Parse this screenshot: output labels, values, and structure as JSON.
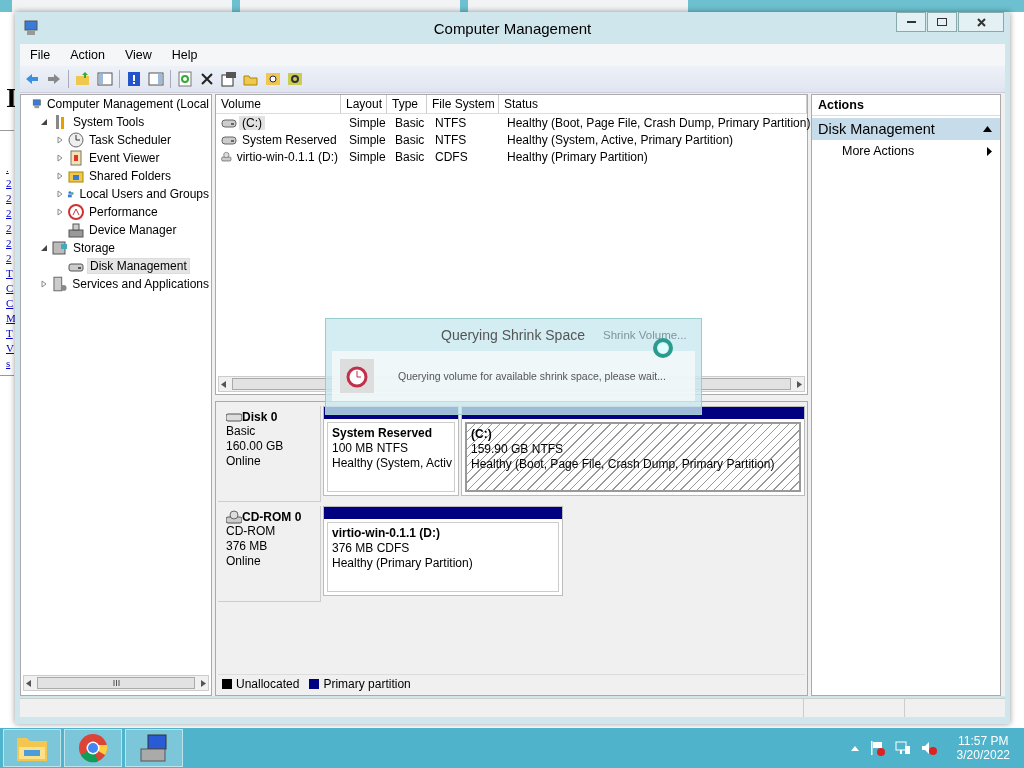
{
  "background_page": {
    "heading_fragment": "I",
    "link_fragments": [
      ".",
      "2",
      "2",
      "2",
      "2",
      "2",
      "2",
      "T",
      "C",
      "C",
      "M",
      "T",
      "V",
      "s"
    ]
  },
  "window": {
    "title": "Computer Management"
  },
  "menu": [
    "File",
    "Action",
    "View",
    "Help"
  ],
  "tree": [
    {
      "label": "Computer Management (Local",
      "selected": false,
      "children": [
        {
          "label": "System Tools",
          "expanded": true,
          "selected": false,
          "children": [
            {
              "label": "Task Scheduler",
              "expanded": false,
              "selected": false
            },
            {
              "label": "Event Viewer",
              "expanded": false,
              "selected": false
            },
            {
              "label": "Shared Folders",
              "expanded": false,
              "selected": false
            },
            {
              "label": "Local Users and Groups",
              "expanded": false,
              "selected": false
            },
            {
              "label": "Performance",
              "expanded": false,
              "selected": false
            },
            {
              "label": "Device Manager",
              "selected": false
            }
          ]
        },
        {
          "label": "Storage",
          "expanded": true,
          "selected": false,
          "children": [
            {
              "label": "Disk Management",
              "selected": true
            }
          ]
        },
        {
          "label": "Services and Applications",
          "expanded": false,
          "selected": false
        }
      ]
    }
  ],
  "volume_table": {
    "columns": [
      "Volume",
      "Layout",
      "Type",
      "File System",
      "Status"
    ],
    "rows": [
      {
        "cells": [
          "(C:)",
          "Simple",
          "Basic",
          "NTFS",
          "Healthy (Boot, Page File, Crash Dump, Primary Partition)"
        ],
        "selected": true,
        "kind": "disk"
      },
      {
        "cells": [
          "System Reserved",
          "Simple",
          "Basic",
          "NTFS",
          "Healthy (System, Active, Primary Partition)"
        ],
        "selected": false,
        "kind": "disk"
      },
      {
        "cells": [
          "virtio-win-0.1.1 (D:)",
          "Simple",
          "Basic",
          "CDFS",
          "Healthy (Primary Partition)"
        ],
        "selected": false,
        "kind": "cd"
      }
    ]
  },
  "disks": [
    {
      "name": "Disk 0",
      "kind": "disk",
      "details": [
        "Basic",
        "160.00 GB",
        "Online"
      ],
      "partitions": [
        {
          "name": "System Reserved",
          "size": "100 MB NTFS",
          "status": "Healthy (System, Activ",
          "selected": false
        },
        {
          "name": "(C:)",
          "size": "159.90 GB NTFS",
          "status": "Healthy (Boot, Page File, Crash Dump, Primary Partition)",
          "selected": true
        }
      ]
    },
    {
      "name": "CD-ROM 0",
      "kind": "cd",
      "details": [
        "CD-ROM",
        "376 MB",
        "Online"
      ],
      "partitions": [
        {
          "name": "virtio-win-0.1.1  (D:)",
          "size": "376 MB CDFS",
          "status": "Healthy (Primary Partition)",
          "selected": false
        }
      ]
    }
  ],
  "legend": [
    {
      "label": "Unallocated",
      "color": "#000000"
    },
    {
      "label": "Primary partition",
      "color": "#000080"
    }
  ],
  "actions": {
    "title": "Actions",
    "section": "Disk Management",
    "items": [
      "More Actions"
    ]
  },
  "dialog": {
    "title": "Querying Shrink Space",
    "behind_title": "Shrink Volume...",
    "message": "Querying volume for available shrink space, please wait..."
  },
  "taskbar": {
    "time": "11:57 PM",
    "date": "3/20/2022"
  }
}
